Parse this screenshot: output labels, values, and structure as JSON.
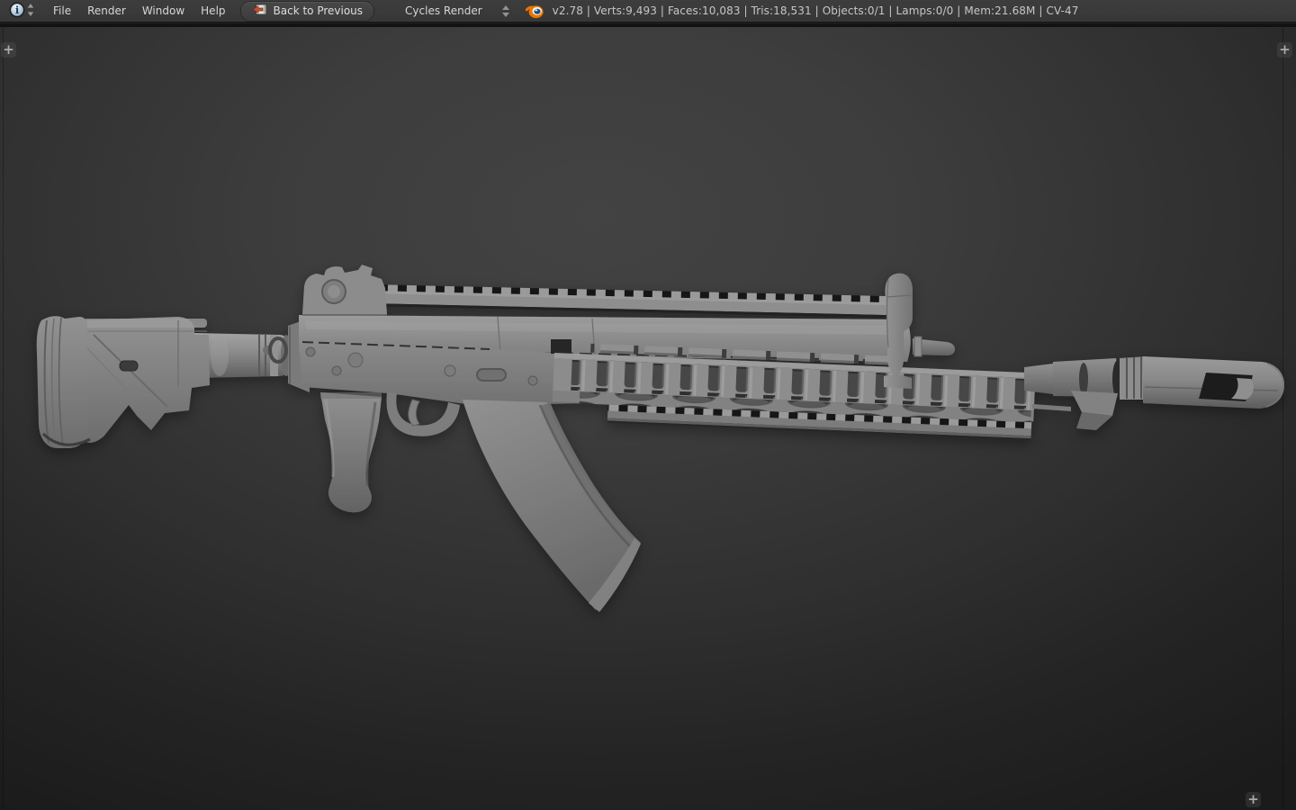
{
  "header": {
    "menus": [
      {
        "label": "File"
      },
      {
        "label": "Render"
      },
      {
        "label": "Window"
      },
      {
        "label": "Help"
      }
    ],
    "back_button": {
      "label": "Back to Previous"
    },
    "render_engine": {
      "value": "Cycles Render"
    },
    "stats": "v2.78 | Verts:9,493 | Faces:10,083 | Tris:18,531 | Objects:0/1 | Lamps:0/0 | Mem:21.68M | CV-47"
  },
  "viewport": {
    "expand_button_glyph": "+",
    "model": "CV-47 assault rifle, solid gray shading"
  },
  "colors": {
    "header_bg": "#3a3a3a",
    "header_text": "#d6d6d6",
    "stats_text": "#c6c6c6",
    "accent_orange": "#ea7600",
    "logo_blue": "#1e4e79",
    "back_arrow_orange": "#c4502c",
    "info_icon_blue": "#9fb6cf",
    "viewport_center": "#424242",
    "viewport_edge": "#1b1b1b",
    "model_gray": "#8a8a8a"
  }
}
